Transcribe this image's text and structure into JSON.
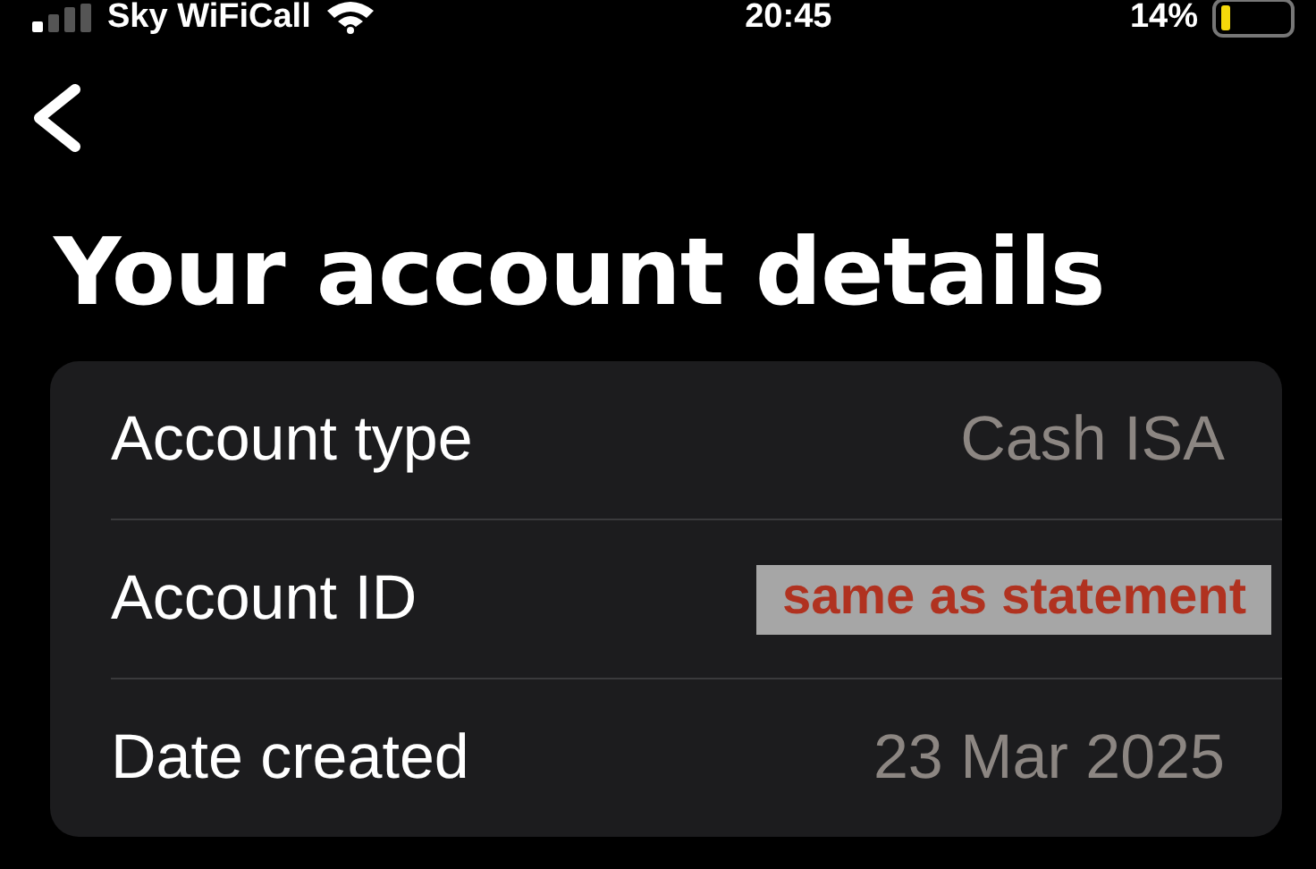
{
  "status_bar": {
    "carrier": "Sky WiFiCall",
    "time": "20:45",
    "battery": "14%"
  },
  "title": "Your account details",
  "rows": [
    {
      "label": "Account type",
      "kind": "text",
      "value": "Cash ISA"
    },
    {
      "label": "Account ID",
      "kind": "redacted",
      "value": "same as statement"
    },
    {
      "label": "Date created",
      "kind": "text",
      "value": "23 Mar 2025"
    }
  ]
}
